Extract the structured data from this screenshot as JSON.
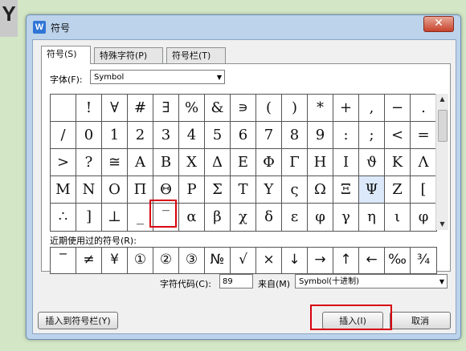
{
  "corner": "Y",
  "window": {
    "title": "符号",
    "close_symbol": "✕"
  },
  "tabs": [
    {
      "label": "符号(S)",
      "active": true
    },
    {
      "label": "特殊字符(P)",
      "active": false
    },
    {
      "label": "符号栏(T)",
      "active": false
    }
  ],
  "font": {
    "label": "字体(F):",
    "value": "Symbol"
  },
  "grid": [
    [
      "",
      "!",
      "∀",
      "#",
      "∃",
      "%",
      "&",
      "∍",
      "(",
      ")",
      "*",
      "+",
      ",",
      "−",
      "."
    ],
    [
      "/",
      "0",
      "1",
      "2",
      "3",
      "4",
      "5",
      "6",
      "7",
      "8",
      "9",
      ":",
      ";",
      "<",
      "="
    ],
    [
      ">",
      "?",
      "≅",
      "Α",
      "Β",
      "Χ",
      "Δ",
      "Ε",
      "Φ",
      "Γ",
      "Η",
      "Ι",
      "ϑ",
      "Κ",
      "Λ"
    ],
    [
      "Μ",
      "Ν",
      "Ο",
      "Π",
      "Θ",
      "Ρ",
      "Σ",
      "Τ",
      "Υ",
      "ς",
      "Ω",
      "Ξ",
      "Ψ",
      "Ζ",
      "["
    ],
    [
      "∴",
      "]",
      "⊥",
      "_",
      "‾",
      "α",
      "β",
      "χ",
      "δ",
      "ε",
      "φ",
      "γ",
      "η",
      "ι",
      "φ"
    ]
  ],
  "selected_cell": {
    "row": 3,
    "col": 12
  },
  "recent": {
    "label": "近期使用过的符号(R):",
    "symbols": [
      "‾",
      "≠",
      "¥",
      "①",
      "②",
      "③",
      "№",
      "√",
      "×",
      "↓",
      "→",
      "↑",
      "←",
      "‰",
      "¾"
    ]
  },
  "char_code": {
    "label": "字符代码(C):",
    "value": "89"
  },
  "from": {
    "label": "来自(M)",
    "value": "Symbol(十进制)"
  },
  "buttons": {
    "insert_to_bar": "插入到符号栏(Y)",
    "insert": "插入(I)",
    "cancel": "取消"
  },
  "colors": {
    "highlight": "#d8000f",
    "selected": "#dce9fb"
  }
}
